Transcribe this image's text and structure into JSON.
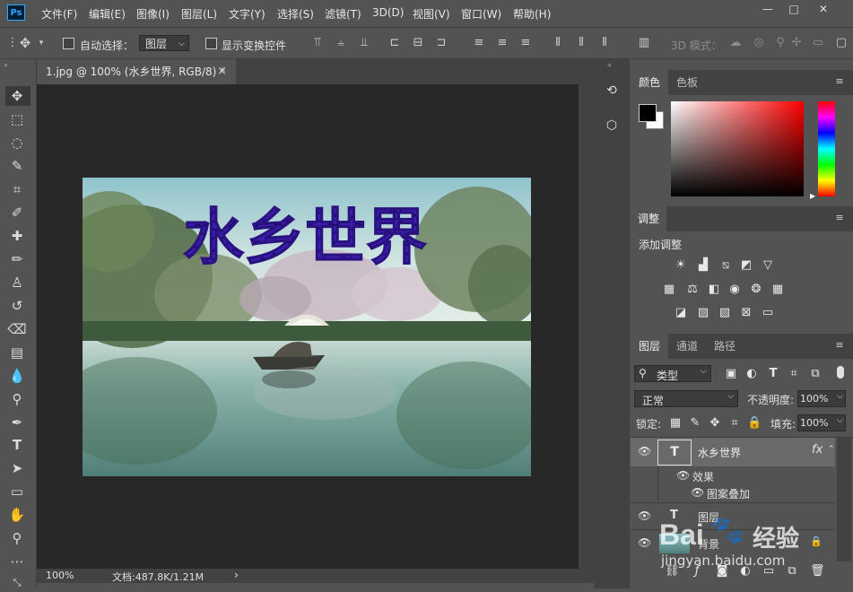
{
  "app": {
    "logo": "Ps"
  },
  "menu": [
    "文件(F)",
    "编辑(E)",
    "图像(I)",
    "图层(L)",
    "文字(Y)",
    "选择(S)",
    "滤镜(T)",
    "3D(D)",
    "视图(V)",
    "窗口(W)",
    "帮助(H)"
  ],
  "window_controls": {
    "minimize": "—",
    "maximize": "□",
    "close": "✕"
  },
  "options_bar": {
    "auto_select_label": "自动选择：",
    "auto_select_value": "图层",
    "show_transform_label": "显示变换控件",
    "mode_3d_label": "3D 模式："
  },
  "document": {
    "tab_title": "1.jpg @ 100% (水乡世界, RGB/8) *",
    "tab_close": "×",
    "canvas_text": "水乡世界",
    "zoom": "100%",
    "doc_info": "文档:487.8K/1.21M",
    "status_arrow": "›"
  },
  "color_panel": {
    "tabs": [
      "颜色",
      "色板"
    ],
    "foreground": "#000000",
    "background": "#ffffff"
  },
  "adjust_panel": {
    "tab": "调整",
    "title": "添加调整"
  },
  "layers_panel": {
    "tabs": [
      "图层",
      "通道",
      "路径"
    ],
    "filter_label": "类型",
    "blend_mode": "正常",
    "opacity_label": "不透明度:",
    "opacity_value": "100%",
    "lock_label": "锁定:",
    "fill_label": "填充:",
    "fill_value": "100%",
    "layers": [
      {
        "name": "水乡世界",
        "type": "text",
        "fx": "fx"
      },
      {
        "name": "效果",
        "type": "effects"
      },
      {
        "name": "图案叠加",
        "type": "effect"
      },
      {
        "name": "图层",
        "type": "text"
      },
      {
        "name": "背景",
        "type": "image"
      }
    ]
  },
  "watermark": {
    "brand": "Bai",
    "brand2": "经验",
    "url": "jingyan.baidu.com"
  },
  "colors": {
    "ui_bg": "#535353",
    "ui_dark": "#424242",
    "canvas_bg": "#282828",
    "text_fill": "#3a1aa8",
    "accent": "#31a8ff"
  }
}
